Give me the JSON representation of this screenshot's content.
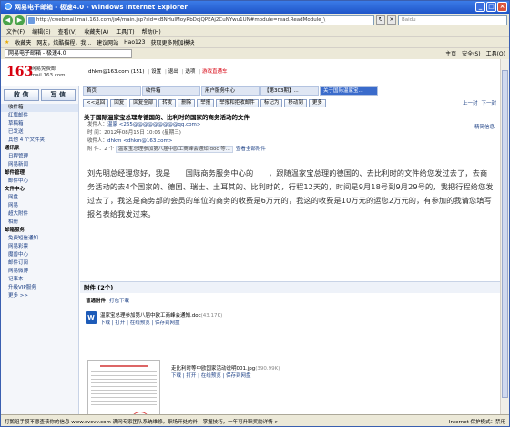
{
  "window": {
    "title": "网易电子邮箱 - 极速4.0 - Windows Internet Explorer"
  },
  "addressbar": {
    "url": "http://cwebmail.mail.163.com/js4/main.jsp?sid=kBNHuIMoyRbDcjQPEAj2CuNYwu1UN#module=read.ReadModule_\\",
    "search_placeholder": "Baidu"
  },
  "menu": [
    "文件(F)",
    "编辑(E)",
    "查看(V)",
    "收藏夹(A)",
    "工具(T)",
    "帮助(H)"
  ],
  "favorites": {
    "label": "收藏夹",
    "items": [
      "网友，炫酷描程，我...",
      "建议网站",
      "Hao123",
      "获取更多附加模块"
    ]
  },
  "tab": {
    "label": "网易电子邮箱 - 极速4.0"
  },
  "tabtools": [
    "主页",
    "安全(S)",
    "工具(O)"
  ],
  "mail": {
    "logo": "163",
    "logo_sub1": "网易免费邮",
    "logo_sub2": "mail.163.com",
    "user": "dhkm@163.com",
    "count": "(151)",
    "links": [
      "设置",
      "退出",
      "选项",
      "游戏直通车"
    ],
    "compose_label": "收 信",
    "write_label": "写 信"
  },
  "sidebar": {
    "items": [
      {
        "label": "收件箱",
        "sel": true,
        "hd": false,
        "extra": ""
      },
      {
        "label": "红旗邮件",
        "sel": false,
        "hd": false,
        "extra": ""
      },
      {
        "label": "草稿箱",
        "sel": false,
        "hd": false,
        "extra": ""
      },
      {
        "label": "已发送",
        "sel": false,
        "hd": false,
        "extra": ""
      },
      {
        "label": "其他 4 个文件夹",
        "sel": false,
        "hd": false,
        "extra": ""
      },
      {
        "label": "通讯录",
        "sel": false,
        "hd": true,
        "extra": ""
      },
      {
        "label": "日程管理",
        "sel": false,
        "hd": false,
        "extra": ""
      },
      {
        "label": "网易新闻",
        "sel": false,
        "hd": false,
        "extra": ""
      },
      {
        "label": "邮件管理",
        "sel": false,
        "hd": true,
        "extra": ""
      },
      {
        "label": "邮件中心",
        "sel": false,
        "hd": false,
        "extra": ""
      },
      {
        "label": "文件中心",
        "sel": false,
        "hd": true,
        "extra": ""
      },
      {
        "label": "网盘",
        "sel": false,
        "hd": false,
        "extra": ""
      },
      {
        "label": "网易",
        "sel": false,
        "hd": false,
        "extra": ""
      },
      {
        "label": "超大附件",
        "sel": false,
        "hd": false,
        "extra": ""
      },
      {
        "label": "相册",
        "sel": false,
        "hd": false,
        "extra": ""
      },
      {
        "label": "邮箱服务",
        "sel": false,
        "hd": true,
        "extra": ""
      },
      {
        "label": "免费短信通知",
        "sel": false,
        "hd": false,
        "extra": ""
      },
      {
        "label": "网易彩票",
        "sel": false,
        "hd": false,
        "extra": ""
      },
      {
        "label": "魔兽中心",
        "sel": false,
        "hd": false,
        "extra": ""
      },
      {
        "label": "邮件订阅",
        "sel": false,
        "hd": false,
        "extra": ""
      },
      {
        "label": "网易微博",
        "sel": false,
        "hd": false,
        "extra": ""
      },
      {
        "label": "记事本",
        "sel": false,
        "hd": false,
        "extra": ""
      },
      {
        "label": "升级VIP服务",
        "sel": false,
        "hd": false,
        "extra": ""
      },
      {
        "label": "更多 >>",
        "sel": false,
        "hd": false,
        "extra": ""
      }
    ]
  },
  "navtabs": [
    "首页",
    "收件箱",
    "用户服务中心",
    "【第303期】...",
    "关于国际温家宝..."
  ],
  "toolbar": {
    "buttons": [
      "<<返回",
      "回复",
      "回复全部",
      "转发",
      "删除",
      "举报",
      "举报和拒收邮件",
      "标记为",
      "移动到",
      "更多"
    ],
    "prev": "上一封",
    "next": "下一封"
  },
  "message": {
    "subject": "关于国际温家宝总理专德国的、比利时的国家的商务活动的文件",
    "from_label": "发件人：",
    "from": "温家 <265@@@@@@@@@qq.com>",
    "time_label": "时 间：",
    "time": "2012年08月15日 10:06 (星期三)",
    "to_label": "收件人：",
    "to": "dhkm <dhkm@163.com>",
    "att_label": "附 件：",
    "att_summary": "2 个",
    "att_chip": "温家宝总理参加第八届中欧工商峰会通知.doc 等...",
    "view_att": "查看全部附件",
    "quick": "精简信息",
    "body": "刘先明总经理您好，我是　　国际商务服务中心的　　，跟随温家宝总理的德国的、去比利时的文件给您发过去了，去商务活动的去4个国家的、德国、瑞士、土耳其的、比利时的，行程12天的，时间是9月18号到9月29号的，我把行程给您发过去了，我这是商务部的会员的单位的商务的收费是6万元的，我这的收费是10万元的运您2万元的，有参加的我请您填写报名表给我发过来。"
  },
  "attachments": {
    "header": "附件 (2个)",
    "mode_label": "普通附件",
    "mode_link": "打包下载",
    "files": [
      {
        "name": "温家宝总理参加第八届中欧工商峰会通知.doc",
        "size": "(43.17K)",
        "links": "下载 | 打开 | 在线预览 | 保存到网盘"
      },
      {
        "name": "走比利时等中欧国家活动说明001.jpg",
        "size": "(390.99K)",
        "links": "下载 | 打开 | 在线预览 | 保存到网盘"
      }
    ]
  },
  "status": {
    "text": "打鹅组手膜不愿查该你的信息   www.cvcvv.com  满网专家团队系统维修。职场开处的外，掌握技巧，一年可升职奖励详情 >",
    "zone": "Internet 保护模式：禁用"
  }
}
